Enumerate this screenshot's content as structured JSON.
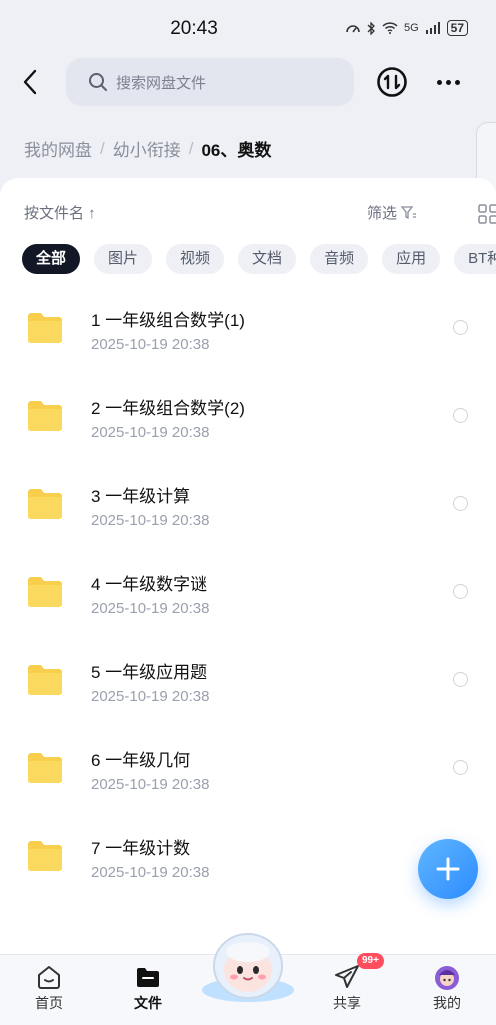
{
  "status_bar": {
    "time": "20:43",
    "network": "5G",
    "battery": "57"
  },
  "header": {
    "search_placeholder": "搜索网盘文件"
  },
  "breadcrumb": {
    "root": "我的网盘",
    "parent": "幼小衔接",
    "current": "06、奥数",
    "separator": "/"
  },
  "toolbar": {
    "sort_label": "按文件名 ↑",
    "filter_label": "筛选"
  },
  "categories": [
    {
      "label": "全部",
      "active": true
    },
    {
      "label": "图片"
    },
    {
      "label": "视频"
    },
    {
      "label": "文档"
    },
    {
      "label": "音频"
    },
    {
      "label": "应用"
    },
    {
      "label": "BT种"
    }
  ],
  "files": [
    {
      "name": "1 一年级组合数学(1)",
      "date": "2025-10-19  20:38",
      "type": "folder"
    },
    {
      "name": "2 一年级组合数学(2)",
      "date": "2025-10-19  20:38",
      "type": "folder"
    },
    {
      "name": "3 一年级计算",
      "date": "2025-10-19  20:38",
      "type": "folder"
    },
    {
      "name": "4 一年级数字谜",
      "date": "2025-10-19  20:38",
      "type": "folder"
    },
    {
      "name": "5 一年级应用题",
      "date": "2025-10-19  20:38",
      "type": "folder"
    },
    {
      "name": "6 一年级几何",
      "date": "2025-10-19  20:38",
      "type": "folder"
    },
    {
      "name": "7 一年级计数",
      "date": "2025-10-19  20:38",
      "type": "folder"
    }
  ],
  "bottom_nav": {
    "home": "首页",
    "files": "文件",
    "share": "共享",
    "share_badge": "99+",
    "me": "我的"
  },
  "colors": {
    "accent": "#2d8cff",
    "folder": "#f8cf4d",
    "badge": "#ff4d5e",
    "active_chip": "#121725"
  }
}
